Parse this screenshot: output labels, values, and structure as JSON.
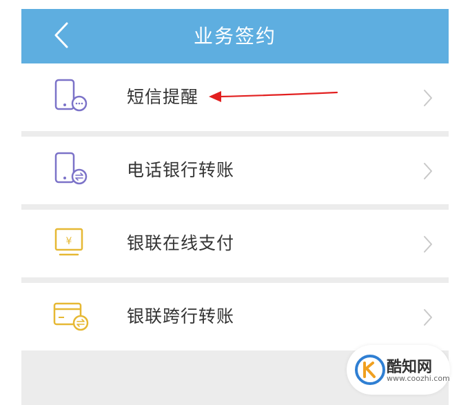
{
  "header": {
    "title": "业务签约",
    "background": "#5eaee0",
    "back_icon": "chevron-left-icon"
  },
  "items": [
    {
      "label": "短信提醒",
      "icon": "phone-sms-icon",
      "icon_color": "#7b72c8"
    },
    {
      "label": "电话银行转账",
      "icon": "phone-transfer-icon",
      "icon_color": "#7b72c8"
    },
    {
      "label": "银联在线支付",
      "icon": "yuan-monitor-icon",
      "icon_color": "#e6b833"
    },
    {
      "label": "银联跨行转账",
      "icon": "card-transfer-icon",
      "icon_color": "#e6b833"
    }
  ],
  "annotation": {
    "color": "#e21f1f",
    "target": "短信提醒"
  },
  "watermark": {
    "name": "酷知网",
    "url": "www.coozhi.com"
  }
}
